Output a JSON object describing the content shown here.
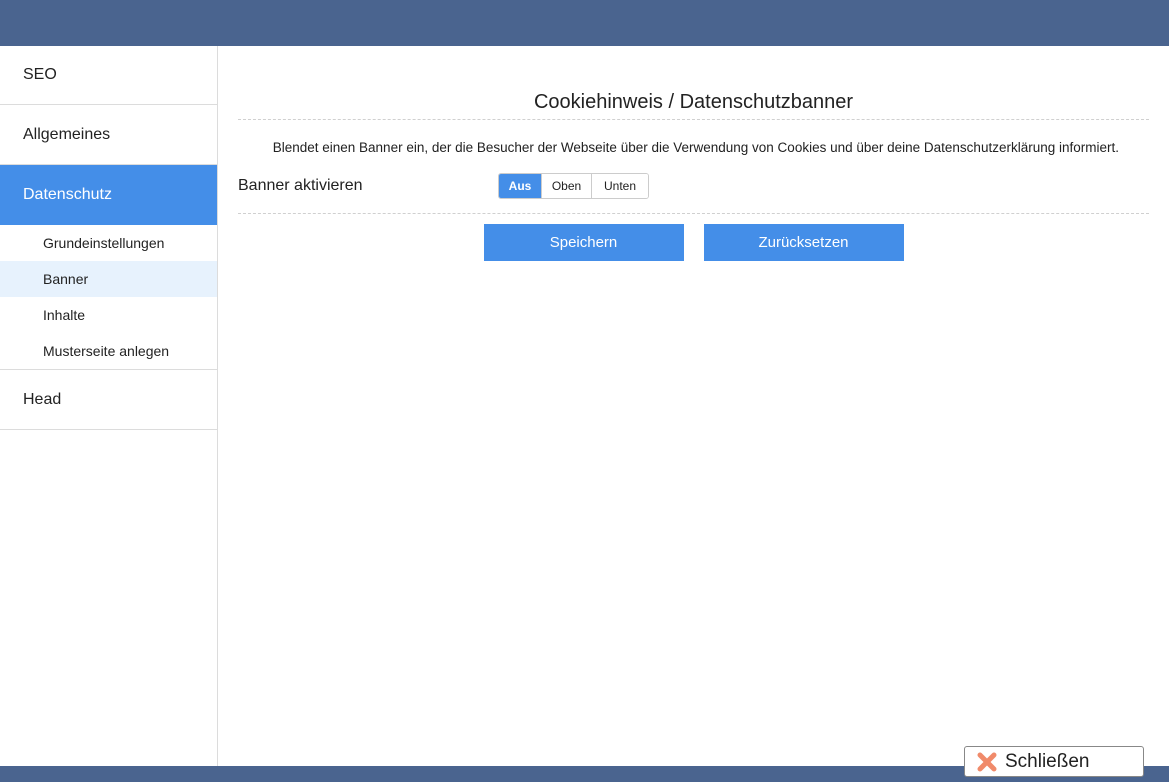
{
  "sidebar": {
    "items": [
      {
        "label": "SEO"
      },
      {
        "label": "Allgemeines"
      },
      {
        "label": "Datenschutz"
      },
      {
        "label": "Head"
      }
    ],
    "subitems": [
      {
        "label": "Grundeinstellungen"
      },
      {
        "label": "Banner"
      },
      {
        "label": "Inhalte"
      },
      {
        "label": "Musterseite anlegen"
      }
    ],
    "active_item": "Datenschutz",
    "active_subitem": "Banner"
  },
  "main": {
    "title": "Cookiehinweis / Datenschutzbanner",
    "description": "Blendet einen Banner ein, der die Besucher der Webseite über die Verwendung von Cookies und über deine Datenschutzerklärung informiert.",
    "banner_label": "Banner aktivieren",
    "banner_options": [
      "Aus",
      "Oben",
      "Unten"
    ],
    "banner_selected": "Aus",
    "save_label": "Speichern",
    "reset_label": "Zurücksetzen"
  },
  "close": {
    "label": "Schließen",
    "icon": "close-icon"
  },
  "colors": {
    "header": "#4a648f",
    "accent": "#448ee8",
    "subitem_active_bg": "#e7f2fd",
    "close_icon": "#f08a6a"
  }
}
